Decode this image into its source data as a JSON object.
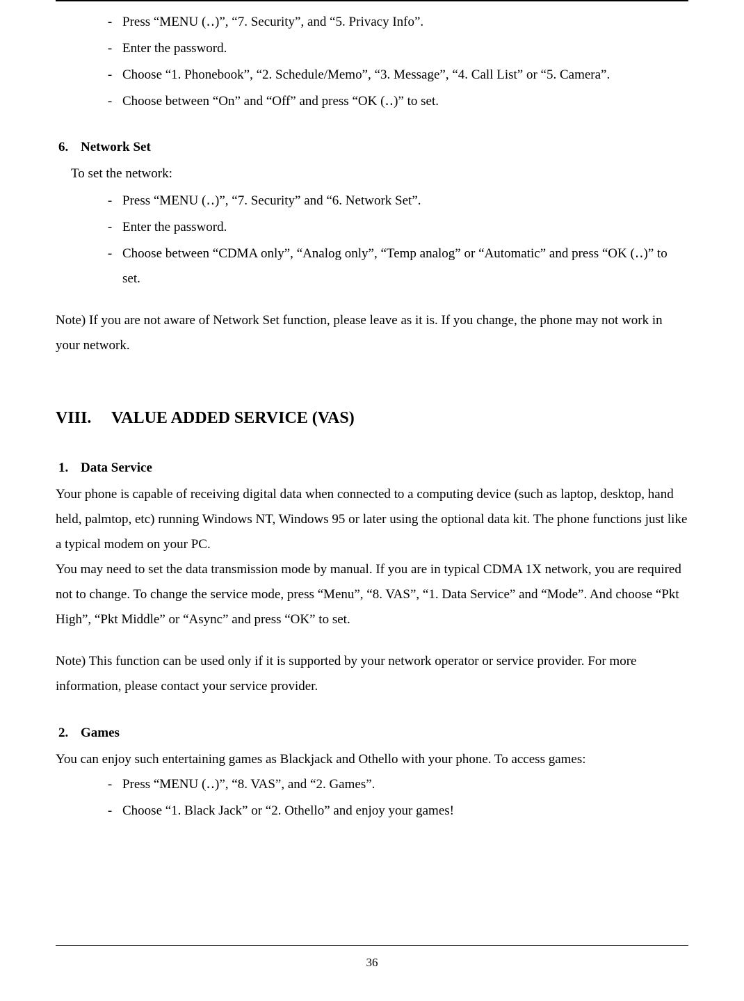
{
  "topList": [
    "Press “MENU (‥)”, “7. Security”, and “5. Privacy Info”.",
    "Enter the password.",
    "Choose “1. Phonebook”, “2. Schedule/Memo”, “3. Message”, “4. Call List” or “5. Camera”.",
    "Choose between “On” and “Off” and press “OK (‥)” to set."
  ],
  "section6": {
    "num": "6.",
    "title": "Network Set",
    "intro": "To set the network:",
    "items": [
      "Press “MENU (‥)”, “7. Security” and “6. Network Set”.",
      "Enter the password.",
      "Choose between “CDMA only”, “Analog only”, “Temp analog” or “Automatic” and press “OK (‥)” to set."
    ],
    "note": "Note) If you are not aware of Network Set function, please leave as it is. If you change, the phone may not work in your network."
  },
  "sectionVIII": {
    "roman": "VIII.",
    "title": "VALUE ADDED SERVICE (VAS)"
  },
  "section1": {
    "num": "1.",
    "title": "Data Service",
    "para1": "Your phone is capable of receiving digital data when connected to a computing device (such as laptop, desktop, hand held, palmtop, etc) running Windows NT, Windows 95 or later using the optional data kit. The phone functions just like a typical modem on your PC.",
    "para2": "You may need to set the data transmission mode by manual. If you are in typical CDMA 1X network, you are required not to change. To change the service mode, press “Menu”, “8. VAS”, “1. Data Service” and “Mode”. And choose “Pkt High”, “Pkt Middle” or “Async” and press “OK” to set.",
    "note": "Note) This function can be used only if it is supported by your network operator or service provider. For more information, please contact your service provider."
  },
  "section2": {
    "num": "2.",
    "title": "Games",
    "intro": "You can enjoy such entertaining games as Blackjack and Othello with your phone. To access games:",
    "items": [
      "Press “MENU (‥)”, “8. VAS”, and “2. Games”.",
      "Choose “1. Black Jack” or “2. Othello” and enjoy your games!"
    ]
  },
  "pageNumber": "36"
}
